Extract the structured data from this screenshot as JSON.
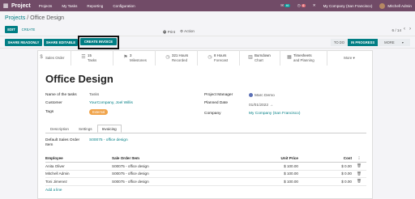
{
  "topbar": {
    "apps_icon": "grid-icon",
    "brand": "Project",
    "menus": [
      "Projects",
      "My Tasks",
      "Reporting",
      "Configuration"
    ],
    "chat_count": "46",
    "activity_count": "6",
    "company": "My Company (San Francisco)",
    "user": "Mitchell Admin"
  },
  "breadcrumb": {
    "parent": "Projects",
    "separator": " / ",
    "current": "Office Design"
  },
  "controls": {
    "edit": "EDIT",
    "create": "CREATE",
    "print": "Print",
    "action": "Action",
    "pager": "6 / 14"
  },
  "header_buttons": {
    "share_readonly": "SHARE READONLY",
    "share_editable": "SHARE EDITABLE",
    "create_invoice": "CREATE INVOICE"
  },
  "stages": [
    "TO DO",
    "IN PROGRESS",
    "MORE"
  ],
  "active_stage": "IN PROGRESS",
  "smart_buttons": [
    {
      "icon": "dollar-icon",
      "value": "",
      "label": "Sales Order"
    },
    {
      "icon": "tasks-icon",
      "value": "15",
      "label": "Tasks"
    },
    {
      "icon": "flag-icon",
      "value": "3",
      "label": "Milestones"
    },
    {
      "icon": "clock-icon",
      "value": "321 Hours",
      "label": "Recorded"
    },
    {
      "icon": "clock-icon",
      "value": "8 Hours",
      "label": "Forecast"
    },
    {
      "icon": "chart-icon",
      "value": "Burndown",
      "label": "Chart"
    },
    {
      "icon": "calendar-icon",
      "value": "Timesheets",
      "label": "and Planning"
    },
    {
      "icon": "",
      "value": "More",
      "label": ""
    }
  ],
  "form": {
    "title": "Office Design",
    "name_label": "Name of the tasks",
    "name_value": "Tasks",
    "customer_label": "Customer",
    "customer_value": "YourCompany, Joel Willis",
    "tags_label": "Tags",
    "tag": "External",
    "manager_label": "Project Manager",
    "manager_value": "Marc Demo",
    "planned_label": "Planned Date",
    "planned_value": "01/01/2022",
    "company_label": "Company",
    "company_value": "My Company (San Francisco)"
  },
  "tabs": [
    "Description",
    "Settings",
    "Invoicing"
  ],
  "active_tab": "Invoicing",
  "invoicing": {
    "default_so_label": "Default Sales Order Item",
    "default_so_value": "S00075 - office design",
    "columns": [
      "Employee",
      "Sale Order Item",
      "Unit Price",
      "Cost"
    ],
    "rows": [
      {
        "employee": "Anita Oliver",
        "item": "S00075 - office design",
        "price": "$ 100.00",
        "cost": "$ 0.00"
      },
      {
        "employee": "Mitchell Admin",
        "item": "S00075 - office design",
        "price": "$ 100.00",
        "cost": "$ 0.00"
      },
      {
        "employee": "Toni Jimenez",
        "item": "S00075 - office design",
        "price": "$ 100.00",
        "cost": "$ 0.00"
      }
    ],
    "add_line": "Add a line"
  },
  "colors": {
    "topbar": "#714b67",
    "primary": "#017e84",
    "tag": "#f0a44b"
  }
}
